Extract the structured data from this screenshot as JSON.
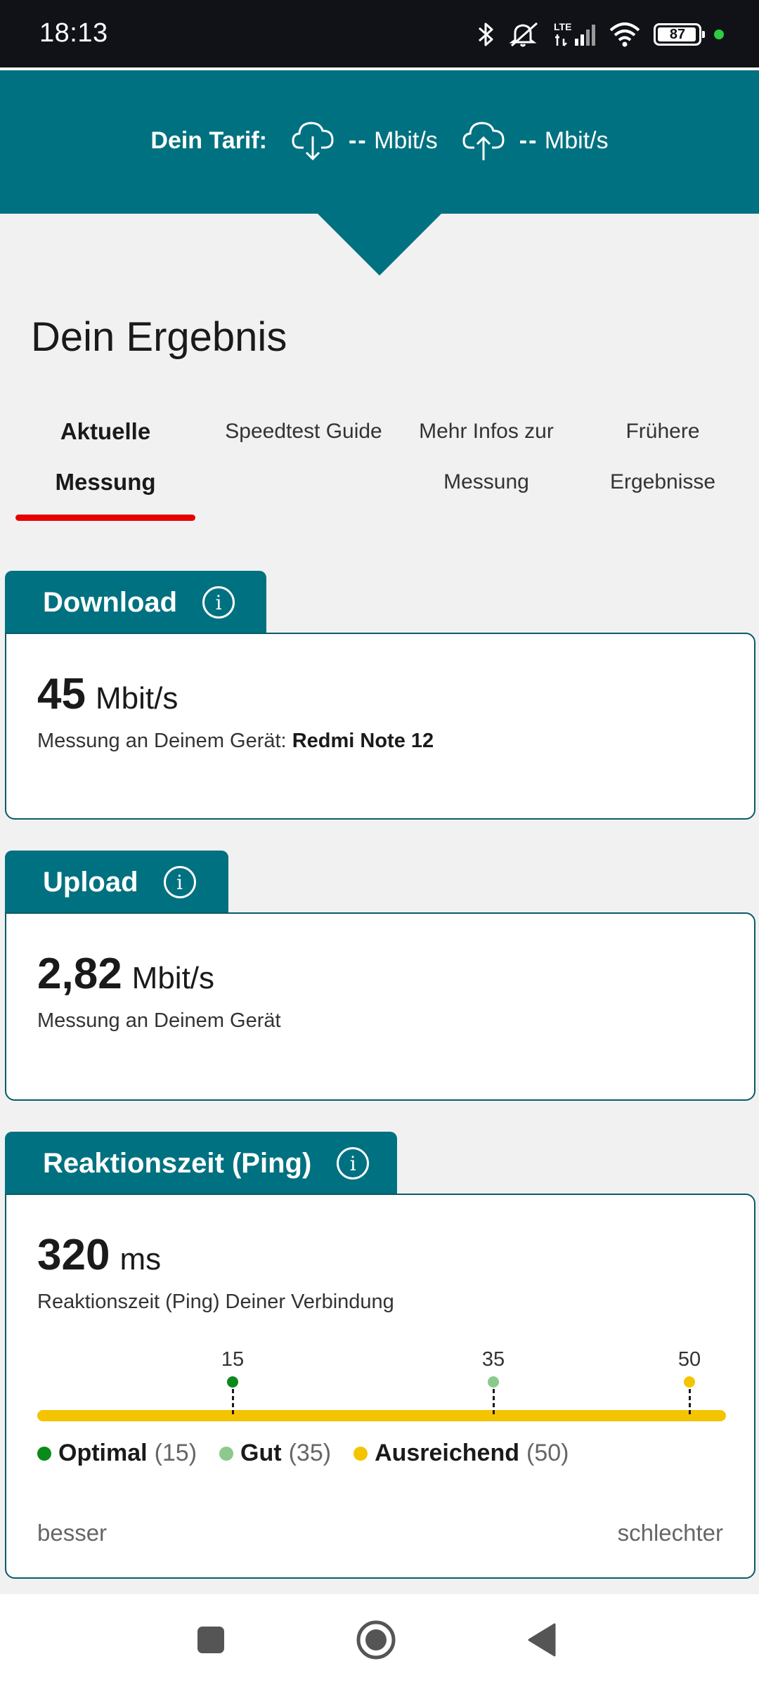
{
  "status_bar": {
    "time": "18:13",
    "battery_level": "87",
    "icons": [
      "bluetooth-icon",
      "mute-icon",
      "lte-signal-icon",
      "wifi-icon",
      "battery-icon"
    ]
  },
  "tarif": {
    "label": "Dein Tarif:",
    "download_value": "--",
    "download_unit": "Mbit/s",
    "upload_value": "--",
    "upload_unit": "Mbit/s"
  },
  "result": {
    "title": "Dein Ergebnis"
  },
  "tabs": [
    {
      "line1": "Aktuelle",
      "line2": "Messung",
      "active": true
    },
    {
      "line1": "Speedtest Guide",
      "line2": "",
      "active": false
    },
    {
      "line1": "Mehr Infos zur",
      "line2": "Messung",
      "active": false
    },
    {
      "line1": "Frühere Ergebnisse",
      "line2": "",
      "active": false
    }
  ],
  "download": {
    "title": "Download",
    "value": "45",
    "unit": "Mbit/s",
    "desc_prefix": "Messung an Deinem Gerät:",
    "device": "Redmi Note 12"
  },
  "upload": {
    "title": "Upload",
    "value": "2,82",
    "unit": "Mbit/s",
    "desc": "Messung an Deinem Gerät"
  },
  "ping": {
    "title": "Reaktionszeit (Ping)",
    "value": "320",
    "unit": "ms",
    "desc": "Reaktionszeit (Ping) Deiner Verbindung",
    "markers": [
      {
        "label": "15",
        "color": "#0a8a1a"
      },
      {
        "label": "35",
        "color": "#8cc98c"
      },
      {
        "label": "50",
        "color": "#f4c400"
      }
    ],
    "bar_color": "#f4c400",
    "legend": [
      {
        "name": "Optimal",
        "value": "(15)",
        "color": "#0a8a1a"
      },
      {
        "name": "Gut",
        "value": "(35)",
        "color": "#8cc98c"
      },
      {
        "name": "Ausreichend",
        "value": "(50)",
        "color": "#f4c400"
      }
    ],
    "left_label": "besser",
    "right_label": "schlechter"
  },
  "colors": {
    "brand_teal": "#007180",
    "accent_red": "#e60000",
    "status_bar": "#101218"
  },
  "navigation": {
    "buttons": [
      "recents-button",
      "home-button",
      "back-button"
    ]
  }
}
